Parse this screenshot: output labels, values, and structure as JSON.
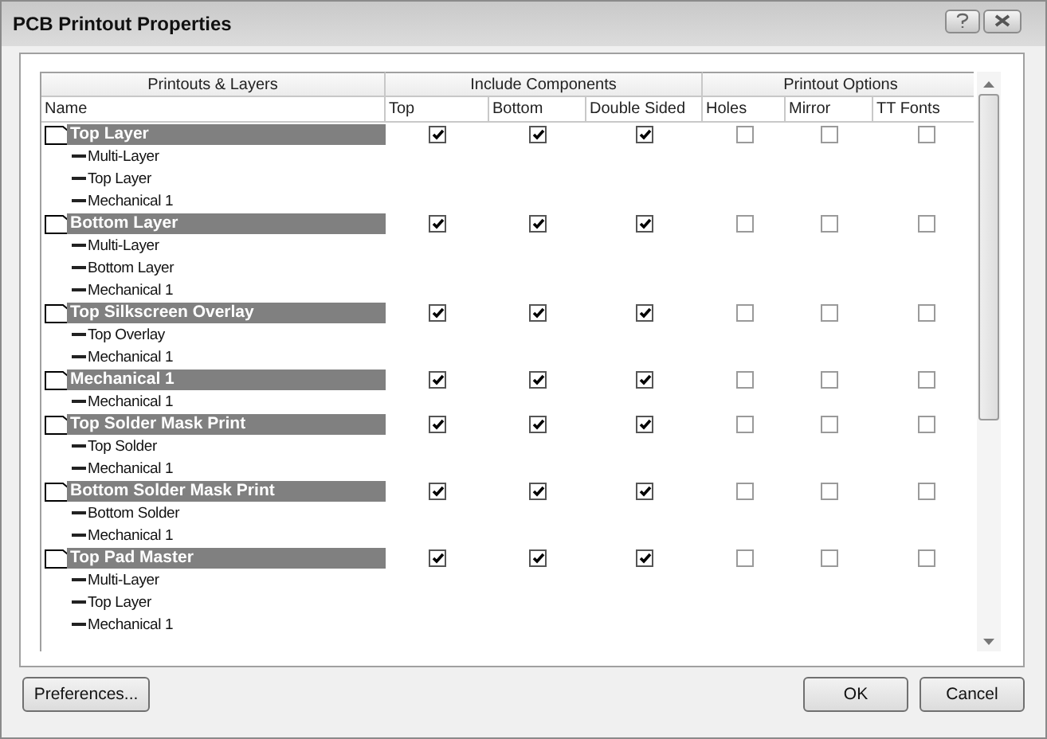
{
  "window": {
    "title": "PCB Printout Properties"
  },
  "table": {
    "column_groups": [
      {
        "label": "Printouts & Layers",
        "columns": [
          "Name"
        ]
      },
      {
        "label": "Include Components",
        "columns": [
          "Top",
          "Bottom",
          "Double Sided"
        ]
      },
      {
        "label": "Printout Options",
        "columns": [
          "Holes",
          "Mirror",
          "TT Fonts"
        ]
      }
    ],
    "printouts": [
      {
        "name": "Top Layer",
        "checks": [
          true,
          true,
          true,
          false,
          false,
          false
        ],
        "children": [
          "Multi-Layer",
          "Top Layer",
          "Mechanical 1"
        ]
      },
      {
        "name": "Bottom Layer",
        "checks": [
          true,
          true,
          true,
          false,
          false,
          false
        ],
        "children": [
          "Multi-Layer",
          "Bottom Layer",
          "Mechanical 1"
        ]
      },
      {
        "name": "Top Silkscreen Overlay",
        "checks": [
          true,
          true,
          true,
          false,
          false,
          false
        ],
        "children": [
          "Top Overlay",
          "Mechanical 1"
        ]
      },
      {
        "name": "Mechanical 1",
        "checks": [
          true,
          true,
          true,
          false,
          false,
          false
        ],
        "children": [
          "Mechanical 1"
        ]
      },
      {
        "name": "Top Solder Mask Print",
        "checks": [
          true,
          true,
          true,
          false,
          false,
          false
        ],
        "children": [
          "Top Solder",
          "Mechanical 1"
        ]
      },
      {
        "name": "Bottom Solder Mask Print",
        "checks": [
          true,
          true,
          true,
          false,
          false,
          false
        ],
        "children": [
          "Bottom Solder",
          "Mechanical 1"
        ]
      },
      {
        "name": "Top Pad Master",
        "checks": [
          true,
          true,
          true,
          false,
          false,
          false
        ],
        "children": [
          "Multi-Layer",
          "Top Layer",
          "Mechanical 1"
        ]
      }
    ]
  },
  "buttons": {
    "left": [
      "Preferences..."
    ],
    "right": [
      "OK",
      "Cancel"
    ]
  }
}
